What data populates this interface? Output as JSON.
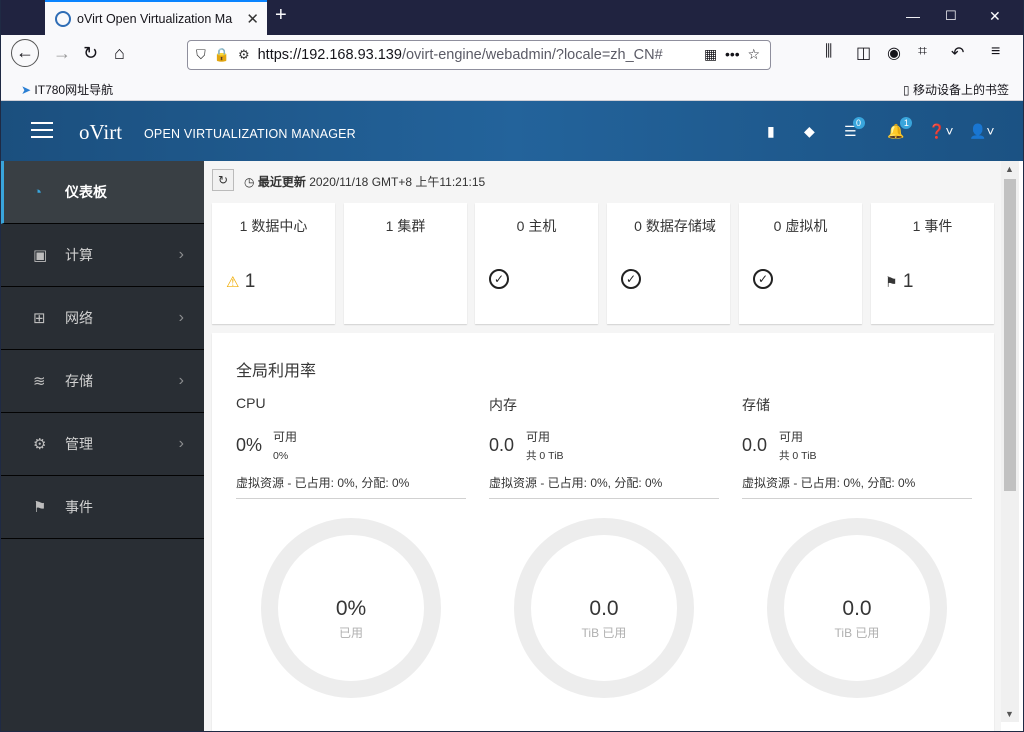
{
  "browser": {
    "tab_title": "oVirt Open Virtualization Ma",
    "url_host": "https://192.168.93.139",
    "url_path": "/ovirt-engine/webadmin/?locale=zh_CN#",
    "bookmark_left": "IT780网址导航",
    "bookmark_right": "移动设备上的书签"
  },
  "header": {
    "logo": "oVirt",
    "title": "OPEN VIRTUALIZATION MANAGER",
    "tasks_badge": "0",
    "alerts_badge": "1"
  },
  "sidebar": {
    "items": [
      {
        "label": "仪表板",
        "icon": "dashboard-icon"
      },
      {
        "label": "计算",
        "icon": "cpu-icon"
      },
      {
        "label": "网络",
        "icon": "network-icon"
      },
      {
        "label": "存储",
        "icon": "database-icon"
      },
      {
        "label": "管理",
        "icon": "gear-icon"
      },
      {
        "label": "事件",
        "icon": "flag-icon"
      }
    ]
  },
  "dashboard": {
    "updated_label": "最近更新",
    "updated_time": "2020/11/18 GMT+8 上午11:21:15",
    "cards": [
      {
        "title": "1 数据中心",
        "stat": "1",
        "status": "warning"
      },
      {
        "title": "1 集群",
        "stat": "",
        "status": "none"
      },
      {
        "title": "0 主机",
        "stat": "",
        "status": "ok"
      },
      {
        "title": "0 数据存储域",
        "stat": "",
        "status": "ok"
      },
      {
        "title": "0 虚拟机",
        "stat": "",
        "status": "ok"
      },
      {
        "title": "1 事件",
        "stat": "1",
        "status": "flag"
      }
    ],
    "utilization": {
      "title": "全局利用率",
      "cpu": {
        "title": "CPU",
        "value": "0%",
        "avail_label": "可用",
        "avail_value": "0%",
        "sub": "虚拟资源 - 已占用: 0%, 分配: 0%",
        "donut_value": "0%",
        "donut_label": "已用"
      },
      "memory": {
        "title": "内存",
        "value": "0.0",
        "avail_label": "可用",
        "avail_value": "共 0 TiB",
        "sub": "虚拟资源 - 已占用: 0%, 分配: 0%",
        "donut_value": "0.0",
        "donut_label": "TiB 已用"
      },
      "storage": {
        "title": "存储",
        "value": "0.0",
        "avail_label": "可用",
        "avail_value": "共 0 TiB",
        "sub": "虚拟资源 - 已占用: 0%, 分配: 0%",
        "donut_value": "0.0",
        "donut_label": "TiB 已用"
      }
    }
  }
}
